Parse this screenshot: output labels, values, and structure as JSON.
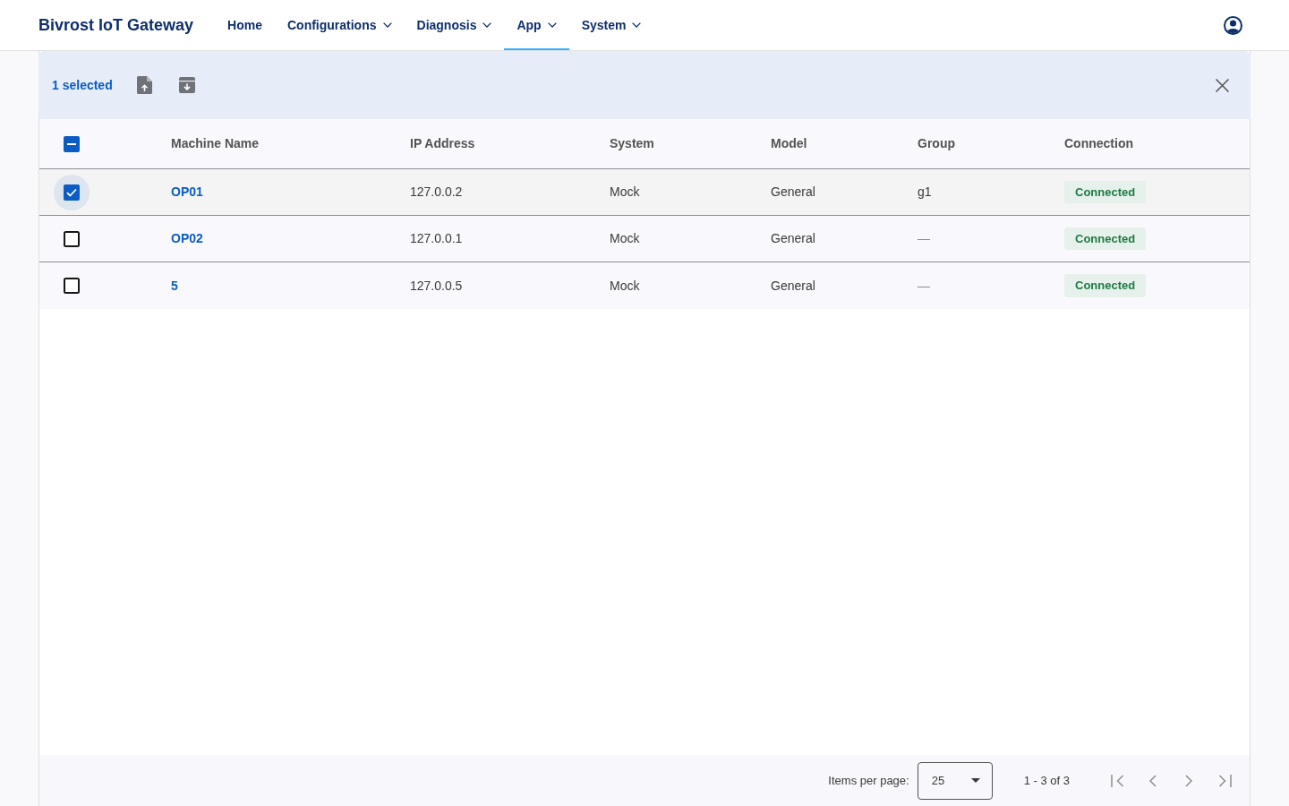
{
  "navbar": {
    "brand": "Bivrost IoT Gateway",
    "items": [
      {
        "label": "Home",
        "has_menu": false,
        "selected": false
      },
      {
        "label": "Configurations",
        "has_menu": true,
        "selected": false
      },
      {
        "label": "Diagnosis",
        "has_menu": true,
        "selected": false
      },
      {
        "label": "App",
        "has_menu": true,
        "selected": true
      },
      {
        "label": "System",
        "has_menu": true,
        "selected": false
      }
    ]
  },
  "selection_bar": {
    "count_label": "1 selected"
  },
  "table": {
    "select_all": {
      "checked": false,
      "indeterminate": true
    },
    "columns": [
      "Machine Name",
      "IP Address",
      "System",
      "Model",
      "Group",
      "Connection"
    ],
    "rows": [
      {
        "selected": true,
        "focused": true,
        "machine_name": "OP01",
        "ip_address": "127.0.0.2",
        "system": "Mock",
        "model": "General",
        "group": "g1",
        "group_muted": false,
        "connection": "Connected"
      },
      {
        "selected": false,
        "focused": false,
        "machine_name": "OP02",
        "ip_address": "127.0.0.1",
        "system": "Mock",
        "model": "General",
        "group": "—",
        "group_muted": true,
        "connection": "Connected"
      },
      {
        "selected": false,
        "focused": false,
        "machine_name": "5",
        "ip_address": "127.0.0.5",
        "system": "Mock",
        "model": "General",
        "group": "—",
        "group_muted": true,
        "connection": "Connected"
      }
    ]
  },
  "pagination": {
    "items_per_page_label": "Items per page:",
    "page_size": "25",
    "range_label": "1 - 3 of 3",
    "buttons": [
      {
        "kind": "first",
        "disabled": true
      },
      {
        "kind": "previous",
        "disabled": true
      },
      {
        "kind": "next",
        "disabled": true
      },
      {
        "kind": "last",
        "disabled": true
      }
    ]
  }
}
